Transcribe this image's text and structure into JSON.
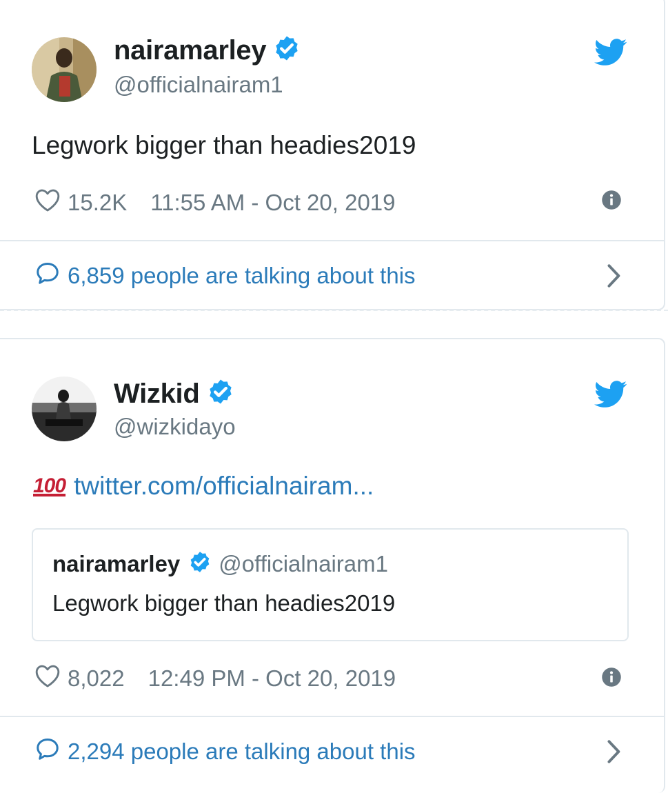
{
  "tweets": [
    {
      "name": "nairamarley",
      "handle": "@officialnairam1",
      "text": "Legwork bigger than headies2019",
      "likes": "15.2K",
      "timestamp": "11:55 AM - Oct 20, 2019",
      "talking": "6,859 people are talking about this"
    },
    {
      "name": "Wizkid",
      "handle": "@wizkidayo",
      "emoji": "100",
      "link": "twitter.com/officialnairam...",
      "quote": {
        "name": "nairamarley",
        "handle": "@officialnairam1",
        "text": "Legwork bigger than headies2019"
      },
      "likes": "8,022",
      "timestamp": "12:49 PM - Oct 20, 2019",
      "talking": "2,294 people are talking about this"
    }
  ],
  "colors": {
    "twitter_blue": "#1da1f2",
    "link_blue": "#2b7bb9",
    "text": "#1c2022",
    "muted": "#697882",
    "border": "#e1e8ed",
    "emoji_red": "#c51f35"
  },
  "icons": [
    "twitter-bird-icon",
    "verified-badge-icon",
    "heart-icon",
    "info-icon",
    "comment-bubble-icon",
    "chevron-right-icon",
    "hundred-points-emoji"
  ]
}
